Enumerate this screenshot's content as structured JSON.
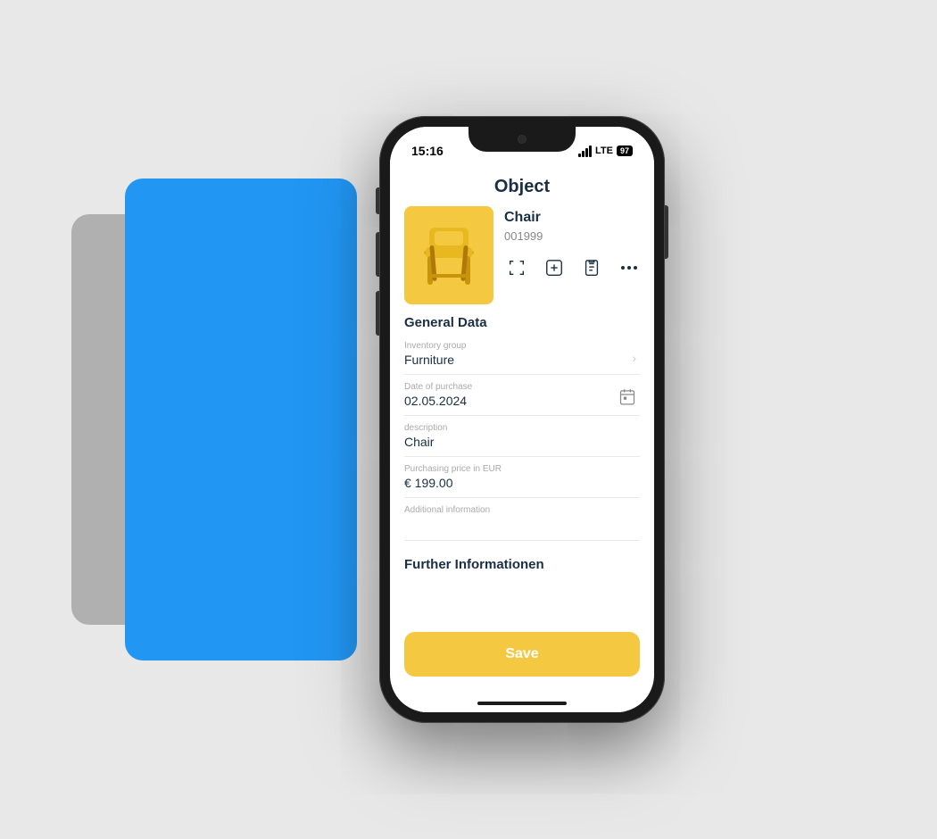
{
  "background": {
    "color": "#e8e8e8"
  },
  "status_bar": {
    "time": "15:16",
    "signal_text": "LTE",
    "battery": "97"
  },
  "app": {
    "title": "Object"
  },
  "object": {
    "name": "Chair",
    "id": "001999"
  },
  "actions": {
    "scan_label": "scan",
    "add_label": "add",
    "list_label": "list",
    "more_label": "more"
  },
  "form": {
    "general_data_title": "General Data",
    "fields": [
      {
        "label": "Inventory group",
        "value": "Furniture",
        "has_chevron": true,
        "has_calendar": false
      },
      {
        "label": "Date of purchase",
        "value": "02.05.2024",
        "has_chevron": false,
        "has_calendar": true
      },
      {
        "label": "description",
        "value": "Chair",
        "has_chevron": false,
        "has_calendar": false
      },
      {
        "label": "Purchasing price in EUR",
        "value": "€ 199.00",
        "has_chevron": false,
        "has_calendar": false
      },
      {
        "label": "Additional information",
        "value": "",
        "has_chevron": false,
        "has_calendar": false
      }
    ],
    "further_section_title": "Further Informationen",
    "save_button_label": "Save"
  }
}
